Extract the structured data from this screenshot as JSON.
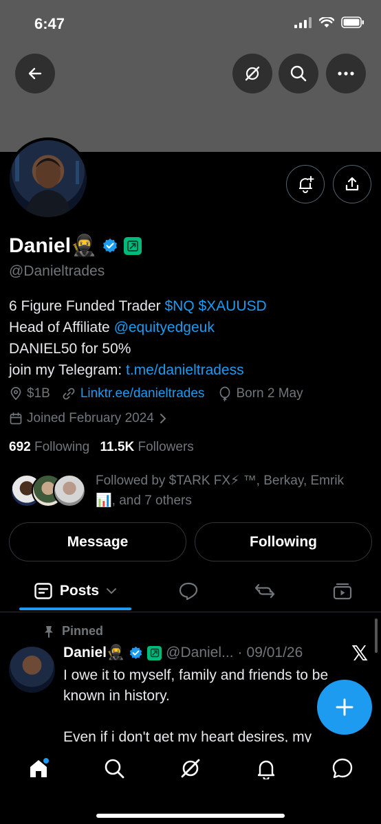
{
  "status_bar": {
    "time": "6:47"
  },
  "profile": {
    "name": "Daniel🥷",
    "handle": "@Danieltrades",
    "bio": {
      "line1_text": "6 Figure Funded Trader ",
      "line1_tags": "$NQ $XAUUSD",
      "line2_text": "Head of Affiliate ",
      "line2_mention": "@equityedgeuk",
      "line3": "DANIEL50 for 50%",
      "line4_text": "join my Telegram: ",
      "line4_link": "t.me/danieltradess"
    },
    "location": "$1B",
    "website": "Linktr.ee/danieltrades",
    "birthday": "Born 2 May",
    "joined": "Joined February 2024",
    "following_count": "692",
    "following_label": "Following",
    "followers_count": "11.5K",
    "followers_label": "Followers",
    "followed_by_line1": "Followed by $TARK FX⚡ ™, Berkay, Emrik",
    "followed_by_line2": "📊, and 7 others"
  },
  "actions": {
    "message": "Message",
    "following": "Following"
  },
  "tabs": {
    "posts": "Posts"
  },
  "post": {
    "pinned_label": "Pinned",
    "author": "Daniel🥷",
    "handle": "@Daniel...",
    "separator": "·",
    "date": "09/01/26",
    "text_line1": "I owe it to myself, family and friends to be",
    "text_line2": "known in history.",
    "text_line3": "Even if i don't get my heart desires, my"
  },
  "colors": {
    "accent": "#1d9bf0",
    "muted": "#71767b",
    "badge_green": "#00ba7c",
    "banner": "#5a5a5a"
  }
}
